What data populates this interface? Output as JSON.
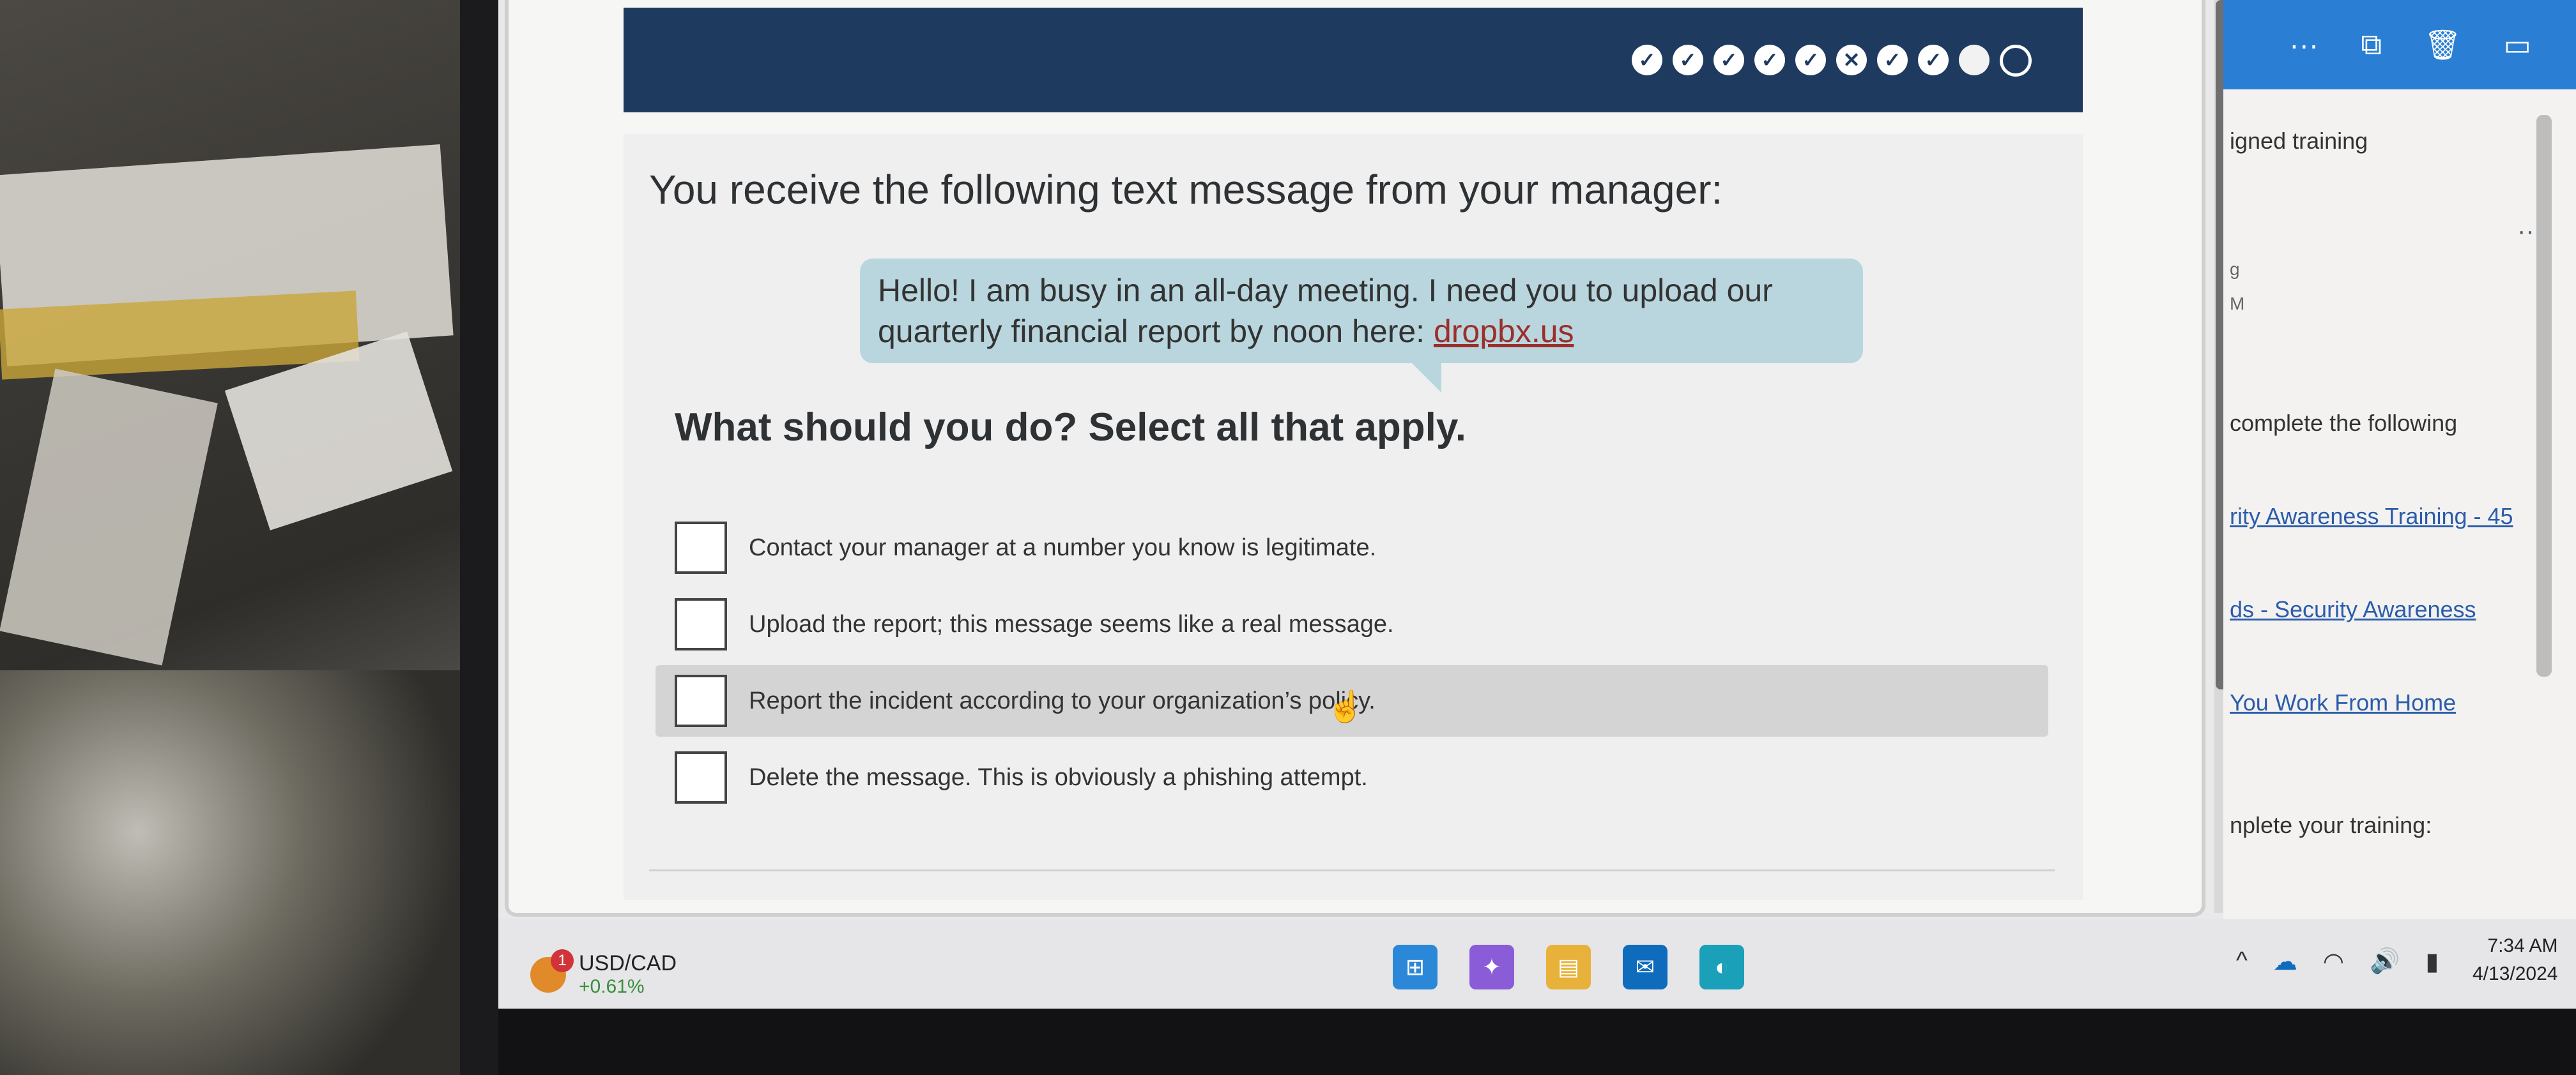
{
  "course": {
    "progress": [
      {
        "state": "correct",
        "glyph": "✓"
      },
      {
        "state": "correct",
        "glyph": "✓"
      },
      {
        "state": "correct",
        "glyph": "✓"
      },
      {
        "state": "correct",
        "glyph": "✓"
      },
      {
        "state": "correct",
        "glyph": "✓"
      },
      {
        "state": "incorrect",
        "glyph": "✕"
      },
      {
        "state": "correct",
        "glyph": "✓"
      },
      {
        "state": "correct",
        "glyph": "✓"
      },
      {
        "state": "current",
        "glyph": ""
      },
      {
        "state": "upcoming",
        "glyph": ""
      }
    ],
    "prompt": "You receive the following text message from your manager:",
    "message_line1": "Hello! I am busy in an all-day meeting. I need you to upload our",
    "message_line2_prefix": "quarterly financial report by noon here: ",
    "message_link": "dropbx.us",
    "question": "What should you do? Select all that apply.",
    "options": [
      {
        "label": "Contact your manager at a number you know is legitimate.",
        "checked": false
      },
      {
        "label": "Upload the report; this message seems like a real message.",
        "checked": false
      },
      {
        "label": "Report the incident according to your organization’s policy.",
        "checked": false
      },
      {
        "label": "Delete the message. This is obviously a phishing attempt.",
        "checked": false
      }
    ],
    "colors": {
      "header": "#1e3a5f",
      "bubble": "#b9d6de",
      "link": "#9c2f2a"
    }
  },
  "outlook": {
    "toolbar_icons": [
      "more-icon",
      "popout-icon",
      "trash-icon",
      "archive-icon"
    ],
    "more_glyph": "···",
    "lines": {
      "assigned": "igned training",
      "marker": "g",
      "time": "M",
      "complete_following": "complete the following",
      "link1": "rity Awareness Training - 45",
      "link2": "ds - Security Awareness",
      "link3": "You Work From Home",
      "footer": "nplete your training:"
    }
  },
  "taskbar": {
    "ticker_name": "USD/CAD",
    "ticker_change": "+0.61%",
    "ticker_badge": "1",
    "time": "7:34 AM",
    "date": "4/13/2024",
    "apps": [
      "start-icon",
      "copilot-icon",
      "file-explorer-icon",
      "outlook-icon",
      "edge-icon"
    ]
  }
}
